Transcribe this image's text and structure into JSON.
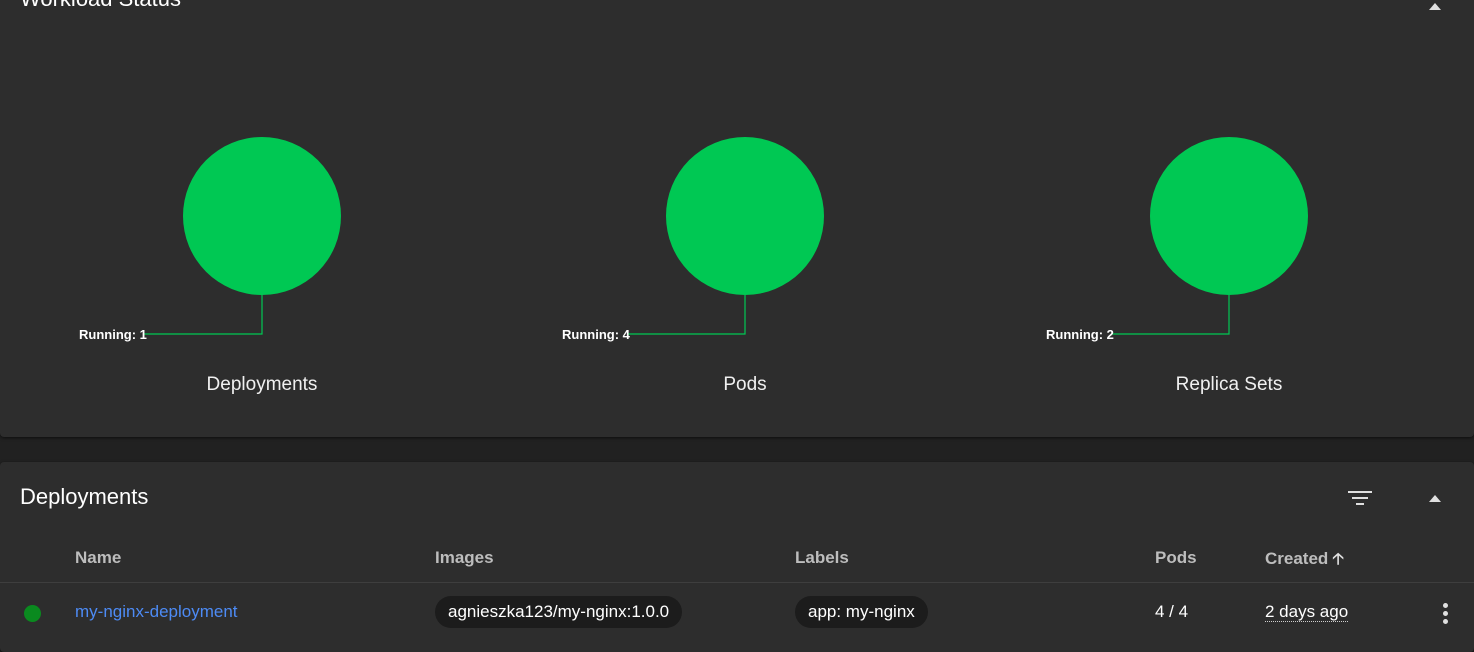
{
  "workload_status": {
    "title": "Workload Status",
    "charts": [
      {
        "caption": "Deployments",
        "running_label": "Running: 1",
        "running": 1
      },
      {
        "caption": "Pods",
        "running_label": "Running: 4",
        "running": 4
      },
      {
        "caption": "Replica Sets",
        "running_label": "Running: 2",
        "running": 2
      }
    ]
  },
  "chart_data": {
    "type": "pie",
    "charts": [
      {
        "title": "Deployments",
        "slices": [
          {
            "name": "Running",
            "value": 1
          }
        ]
      },
      {
        "title": "Pods",
        "slices": [
          {
            "name": "Running",
            "value": 4
          }
        ]
      },
      {
        "title": "Replica Sets",
        "slices": [
          {
            "name": "Running",
            "value": 2
          }
        ]
      }
    ]
  },
  "deployments": {
    "title": "Deployments",
    "columns": {
      "name": "Name",
      "images": "Images",
      "labels": "Labels",
      "pods": "Pods",
      "created": "Created"
    },
    "sort_icon": "arrow-up-icon",
    "rows": [
      {
        "status": "running",
        "name": "my-nginx-deployment",
        "image": "agnieszka123/my-nginx:1.0.0",
        "label": "app: my-nginx",
        "pods": "4 / 4",
        "created": "2 days ago"
      }
    ]
  },
  "colors": {
    "running": "#00c853",
    "status_dot": "#0a8a1f",
    "link": "#4d8bf5",
    "card_bg": "#2d2d2d",
    "page_bg": "#212121"
  }
}
